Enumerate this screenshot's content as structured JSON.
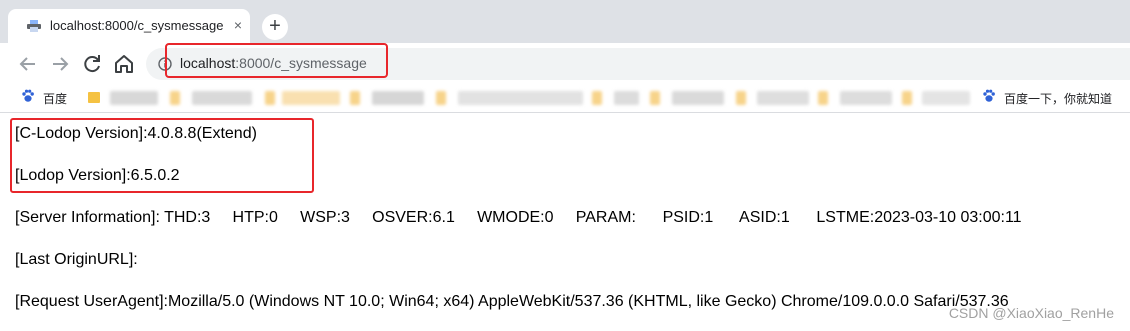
{
  "browser": {
    "tab": {
      "title": "localhost:8000/c_sysmessage",
      "close_glyph": "×"
    },
    "new_tab_glyph": "+",
    "address": {
      "host": "localhost",
      "path": ":8000/c_sysmessage"
    },
    "bookmarks": {
      "first": "百度",
      "last": "百度一下，你就知道"
    }
  },
  "page": {
    "c_lodop": "[C-Lodop Version]:4.0.8.8(Extend)",
    "lodop": "[Lodop Version]:6.5.0.2",
    "server_info": "[Server Information]: THD:3     HTP:0     WSP:3     OSVER:6.1     WMODE:0     PARAM:      PSID:1      ASID:1      LSTME:2023-03-10 03:00:11",
    "origin_url": "[Last OriginURL]:",
    "user_agent": "[Request UserAgent]:Mozilla/5.0 (Windows NT 10.0; Win64; x64) AppleWebKit/537.36 (KHTML, like Gecko) Chrome/109.0.0.0 Safari/537.36"
  },
  "watermark": "CSDN @XiaoXiao_RenHe",
  "colors": {
    "highlight": "#e8262b",
    "tabstrip": "#dee1e6",
    "omnibox": "#f1f3f4"
  },
  "icons": [
    "printer-favicon-icon",
    "back-icon",
    "forward-icon",
    "reload-icon",
    "home-icon",
    "info-icon",
    "paw-icon",
    "folder-icon"
  ]
}
